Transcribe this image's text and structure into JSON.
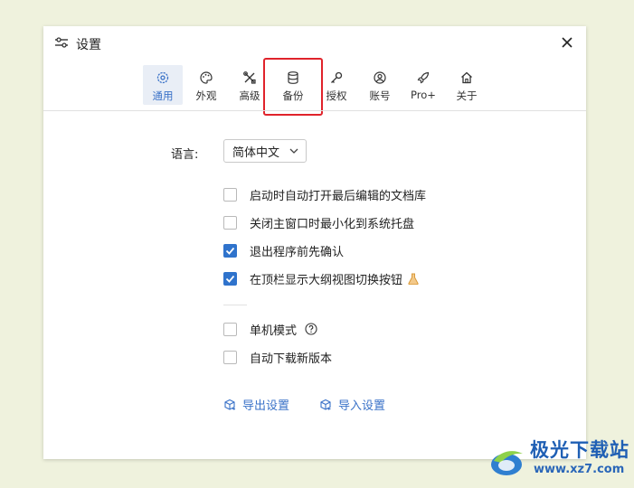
{
  "dialog": {
    "title": "设置",
    "title_icon": "sliders-icon",
    "close_icon": "close-icon"
  },
  "tabs": [
    {
      "label": "通用",
      "icon": "gear-icon",
      "active": true
    },
    {
      "label": "外观",
      "icon": "palette-icon",
      "active": false
    },
    {
      "label": "高级",
      "icon": "tools-icon",
      "active": false
    },
    {
      "label": "备份",
      "icon": "database-icon",
      "active": false,
      "highlighted": true
    },
    {
      "label": "授权",
      "icon": "key-icon",
      "active": false
    },
    {
      "label": "账号",
      "icon": "user-circle-icon",
      "active": false
    },
    {
      "label": "Pro+",
      "icon": "rocket-icon",
      "active": false
    },
    {
      "label": "关于",
      "icon": "home-icon",
      "active": false
    }
  ],
  "language": {
    "label": "语言:",
    "value": "简体中文"
  },
  "options": [
    {
      "label": "启动时自动打开最后编辑的文档库",
      "checked": false
    },
    {
      "label": "关闭主窗口时最小化到系统托盘",
      "checked": false
    },
    {
      "label": "退出程序前先确认",
      "checked": true
    },
    {
      "label": "在顶栏显示大纲视图切换按钮",
      "checked": true,
      "badge_icon": "flask-icon"
    }
  ],
  "options2": [
    {
      "label": "单机模式",
      "checked": false,
      "help_icon": "question-circle-icon"
    },
    {
      "label": "自动下载新版本",
      "checked": false
    }
  ],
  "links": {
    "export": "导出设置",
    "import": "导入设置"
  },
  "watermark": {
    "brand": "极光下载站",
    "url": "www.xz7.com"
  },
  "colors": {
    "accent": "#2f73cc",
    "highlight": "#e0232b",
    "background": "#eff2dd"
  }
}
